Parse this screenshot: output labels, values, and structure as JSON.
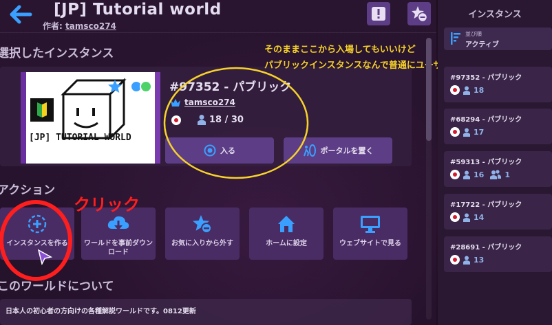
{
  "header": {
    "title": "[JP] Tutorial world",
    "author_label": "作者:",
    "author_name": "tamsco274"
  },
  "selected_instance": {
    "section_title": "選択したインスタンス",
    "id_label": "#97352 - パブリック",
    "owner": "tamsco274",
    "user_count": "18 / 30",
    "join_label": "入る",
    "portal_label": "ポータルを置く",
    "thumbnail_text": "[JP] TUTORIAL WORLD"
  },
  "annotation": {
    "line1": "そのままここから入場してもいいけど",
    "line2": "パブリックインスタンスなんで普通にユーザーいます。",
    "click_label": "クリック",
    "color": "#f6d22a",
    "click_color": "#ff1e1e"
  },
  "actions": {
    "section_title": "アクション",
    "tiles": [
      {
        "label": "インスタンスを作る",
        "icon": "create-instance-icon"
      },
      {
        "label": "ワールドを事前ダウンロード",
        "icon": "cloud-download-icon"
      },
      {
        "label": "お気に入りから外す",
        "icon": "unfavorite-icon"
      },
      {
        "label": "ホームに設定",
        "icon": "home-icon"
      },
      {
        "label": "ウェブサイトで見る",
        "icon": "monitor-icon"
      }
    ]
  },
  "about": {
    "section_title": "このワールドについて",
    "description": "日本人の初心者の方向けの各種解説ワールドです。0812更新"
  },
  "sidebar": {
    "title": "インスタンス",
    "sort_label": "並び順",
    "sort_value": "アクティブ",
    "instances": [
      {
        "id": "#97352 - パブリック",
        "users": "18",
        "friends": ""
      },
      {
        "id": "#68294 - パブリック",
        "users": "17",
        "friends": ""
      },
      {
        "id": "#59313 - パブリック",
        "users": "16",
        "friends": "1"
      },
      {
        "id": "#17722 - パブリック",
        "users": "14",
        "friends": ""
      },
      {
        "id": "#28691 - パブリック",
        "users": "13",
        "friends": ""
      }
    ]
  },
  "colors": {
    "button": "#5d3d86",
    "accent_blue": "#3aa0ff",
    "flag_red": "#d31a2e"
  }
}
